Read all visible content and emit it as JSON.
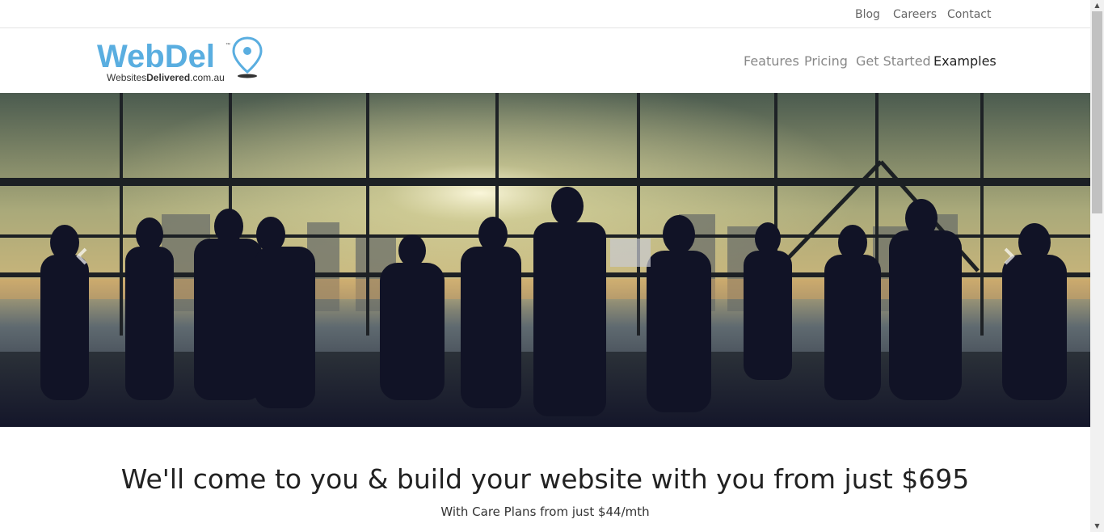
{
  "utility_nav": {
    "blog": "Blog",
    "careers": "Careers",
    "contact": "Contact"
  },
  "logo": {
    "brand": "WebDel",
    "tm": "™",
    "tagline_prefix": "Websites",
    "tagline_bold": "Delivered",
    "tagline_suffix": ".com.au"
  },
  "main_nav": {
    "features": "Features",
    "pricing": "Pricing",
    "get_started": "Get Started",
    "examples": "Examples",
    "active": "Examples"
  },
  "carousel": {
    "prev_icon": "chevron-left-icon",
    "next_icon": "chevron-right-icon"
  },
  "hero": {
    "title": "We'll come to you & build your website with you from just $695",
    "subtitle": "With Care Plans from just $44/mth"
  },
  "colors": {
    "brand_blue": "#5aaee0",
    "brand_dark": "#3a3a3a",
    "nav_text": "#888888",
    "nav_active": "#222222"
  }
}
